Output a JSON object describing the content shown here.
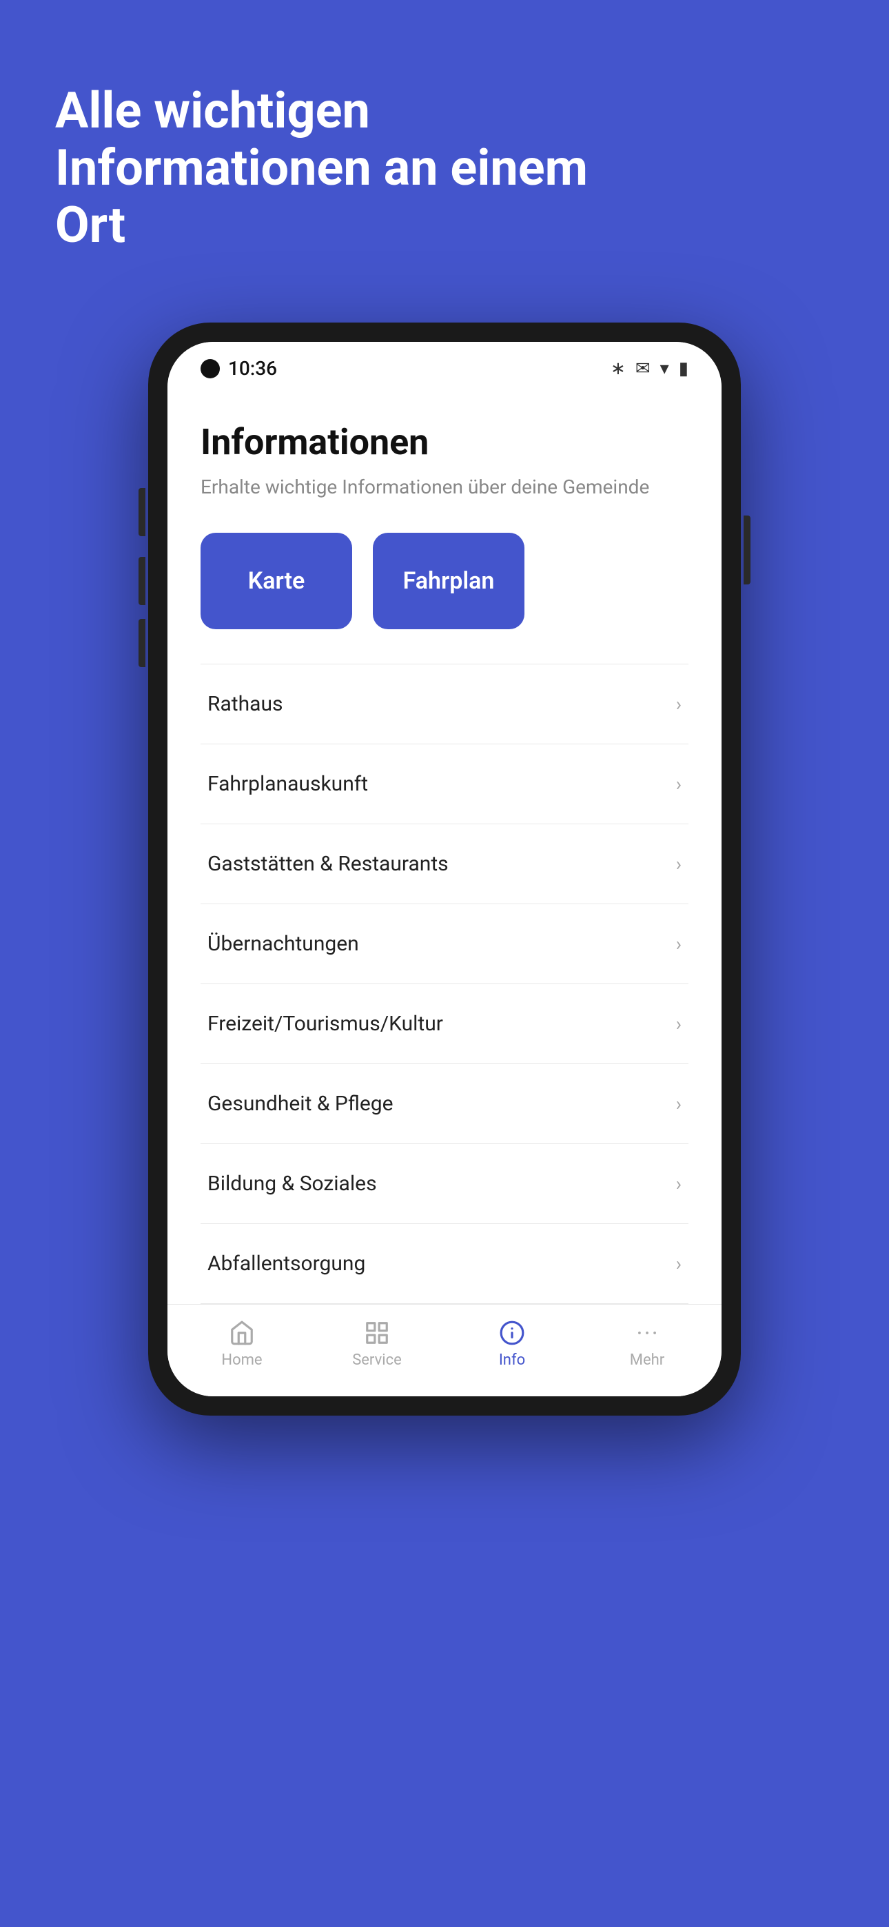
{
  "background_color": "#4455CC",
  "hero": {
    "text": "Alle wichtigen Informationen an einem Ort"
  },
  "phone": {
    "status_bar": {
      "time": "10:36",
      "icons": [
        "bluetooth",
        "bell-off",
        "wifi",
        "battery"
      ]
    },
    "app": {
      "title": "Informationen",
      "subtitle": "Erhalte wichtige Informationen über deine Gemeinde",
      "quick_actions": [
        {
          "label": "Karte"
        },
        {
          "label": "Fahrplan"
        }
      ],
      "list_items": [
        {
          "label": "Rathaus"
        },
        {
          "label": "Fahrplanauskunft"
        },
        {
          "label": "Gaststätten & Restaurants"
        },
        {
          "label": "Übernachtungen"
        },
        {
          "label": "Freizeit/Tourismus/Kultur"
        },
        {
          "label": "Gesundheit & Pflege"
        },
        {
          "label": "Bildung & Soziales"
        },
        {
          "label": "Abfallentsorgung"
        }
      ]
    },
    "bottom_nav": [
      {
        "label": "Home",
        "icon": "home",
        "active": false
      },
      {
        "label": "Service",
        "icon": "grid",
        "active": false
      },
      {
        "label": "Info",
        "icon": "info",
        "active": true
      },
      {
        "label": "Mehr",
        "icon": "dots",
        "active": false
      }
    ]
  }
}
